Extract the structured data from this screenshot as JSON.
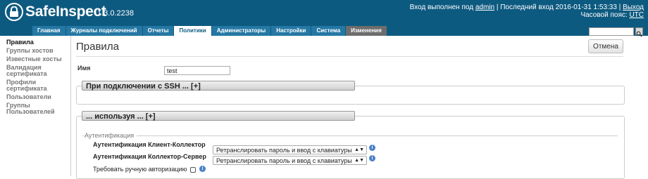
{
  "header": {
    "logo_text": "SafeInspect",
    "version": "1.3.0.2238",
    "login_prefix": "Вход выполнен под ",
    "user": "admin",
    "last_login": " | Последний вход 2016-01-31 1:53:33 | ",
    "logout": "Выход",
    "timezone_label": "Часовой пояс: ",
    "timezone": "UTC"
  },
  "nav": {
    "tabs": [
      "Главная",
      "Журналы подключений",
      "Отчеты",
      "Политики",
      "Администраторы",
      "Настройки",
      "Система",
      "Изменения"
    ],
    "active_index": 3
  },
  "sidebar": {
    "items": [
      "Правила",
      "Группы хостов",
      "Известные хосты",
      "Валидация сертификата",
      "Профили сертификата",
      "Пользователи",
      "Группы Пользователей"
    ]
  },
  "main": {
    "title": "Правила",
    "cancel_label": "Отмена",
    "name_label": "Имя",
    "name_value": "test",
    "ssh_panel_title": "При подключении с SSH ... [+]",
    "using_panel_title": "... используя ... [+]",
    "auth_legend": "Аутентификация",
    "auth_client_label": "Аутентификация Клиент-Коллектор",
    "auth_client_value": "Ретранслировать пароль и ввод с клавиатуры",
    "auth_server_label": "Аутентификация Коллектор-Сервер",
    "auth_server_value": "Ретранслировать пароль и ввод с клавиатуры",
    "manual_auth_label": "Требовать ручную авторизацию"
  },
  "colors": {
    "header_bg": "#0d5a80",
    "tab_bg": "#2578a4",
    "changes_tab_bg": "#6d6d6d",
    "info_icon": "#4a80c8"
  }
}
